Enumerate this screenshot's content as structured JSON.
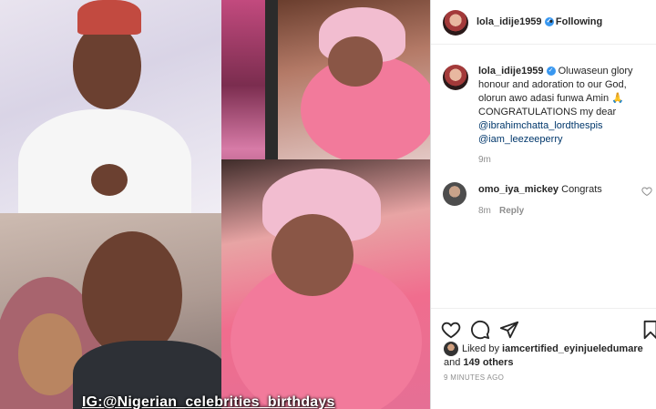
{
  "media": {
    "watermark": "IG:@Nigerian_celebrities_birthdays"
  },
  "post": {
    "author": "lola_idije1959",
    "follow_state": "Following",
    "caption_author": "lola_idije1959",
    "caption_text": "Oluwaseun glory honour and adoration to our God, olorun awo adasi funwa Amin 🙏 CONGRATULATIONS my dear",
    "mentions": [
      "@ibrahimchatta_lordthespis",
      "@iam_leezeeperry"
    ],
    "caption_time": "9m"
  },
  "comment": {
    "username": "omo_iya_mickey",
    "text": "Congrats",
    "time": "8m",
    "reply_label": "Reply"
  },
  "likes": {
    "prefix": "Liked by",
    "user": "iamcertified_eyinjueledumare",
    "conj": "and",
    "others": "149 others"
  },
  "timestamp": "9 MINUTES AGO",
  "colors": {
    "verified": "#3897f0",
    "mention": "#00376b",
    "muted": "#8e8e8e"
  },
  "icons": [
    "heart-icon",
    "comment-icon",
    "share-icon",
    "bookmark-icon",
    "verified-icon",
    "small-heart-icon"
  ]
}
